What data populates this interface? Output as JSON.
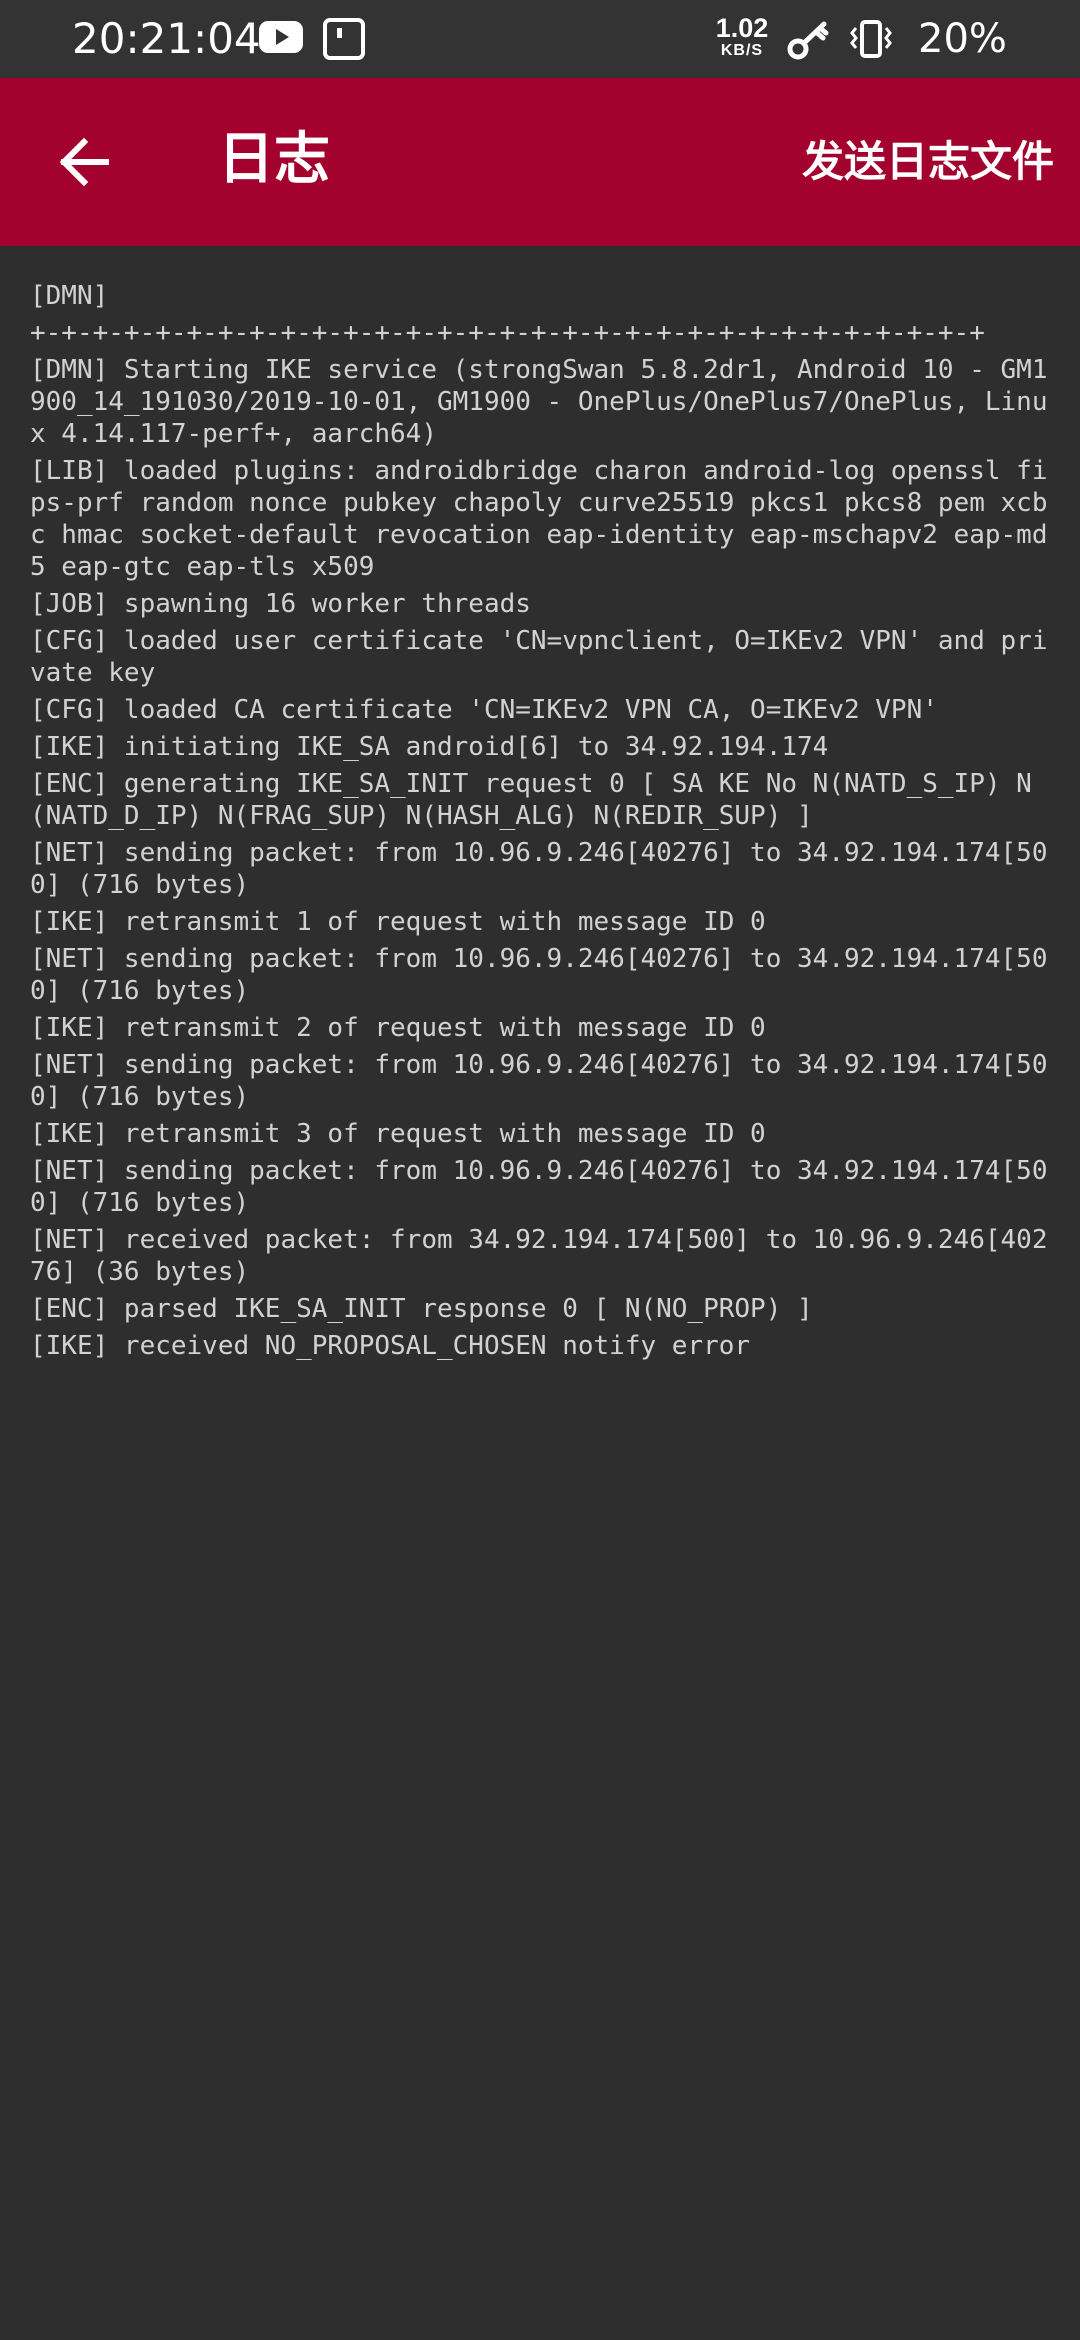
{
  "status_bar": {
    "time": "20:21:04",
    "net_speed_value": "1.02",
    "net_speed_unit": "KB/S",
    "battery": "20%",
    "icons": [
      "youtube-icon",
      "gallery-icon",
      "key-icon",
      "vibrate-icon"
    ]
  },
  "app_bar": {
    "title": "日志",
    "action": "发送日志文件",
    "back_icon": "arrow-back-icon",
    "color": "#a3022f"
  },
  "log": {
    "lines": [
      "[DMN]",
      "+-+-+-+-+-+-+-+-+-+-+-+-+-+-+-+-+-+-+-+-+-+-+-+-+-+-+-+-+-+-+",
      "[DMN] Starting IKE service (strongSwan 5.8.2dr1, Android 10 - GM1900_14_191030/2019-10-01, GM1900 - OnePlus/OnePlus7/OnePlus, Linux 4.14.117-perf+, aarch64)",
      "[LIB] loaded plugins: androidbridge charon android-log openssl fips-prf random nonce pubkey chapoly curve25519 pkcs1 pkcs8 pem xcbc hmac socket-default revocation eap-identity eap-mschapv2 eap-md5 eap-gtc eap-tls x509",
      "[JOB] spawning 16 worker threads",
      "[CFG] loaded user certificate 'CN=vpnclient, O=IKEv2 VPN' and private key",
      "[CFG] loaded CA certificate 'CN=IKEv2 VPN CA, O=IKEv2 VPN'",
      "[IKE] initiating IKE_SA android[6] to 34.92.194.174",
      "[ENC] generating IKE_SA_INIT request 0 [ SA KE No N(NATD_S_IP) N(NATD_D_IP) N(FRAG_SUP) N(HASH_ALG) N(REDIR_SUP) ]",
      "[NET] sending packet: from 10.96.9.246[40276] to 34.92.194.174[500] (716 bytes)",
      "[IKE] retransmit 1 of request with message ID 0",
      "[NET] sending packet: from 10.96.9.246[40276] to 34.92.194.174[500] (716 bytes)",
      "[IKE] retransmit 2 of request with message ID 0",
      "[NET] sending packet: from 10.96.9.246[40276] to 34.92.194.174[500] (716 bytes)",
      "[IKE] retransmit 3 of request with message ID 0",
      "[NET] sending packet: from 10.96.9.246[40276] to 34.92.194.174[500] (716 bytes)",
      "[NET] received packet: from 34.92.194.174[500] to 10.96.9.246[40276] (36 bytes)",
      "[ENC] parsed IKE_SA_INIT response 0 [ N(NO_PROP) ]",
      "[IKE] received NO_PROPOSAL_CHOSEN notify error"
    ]
  }
}
